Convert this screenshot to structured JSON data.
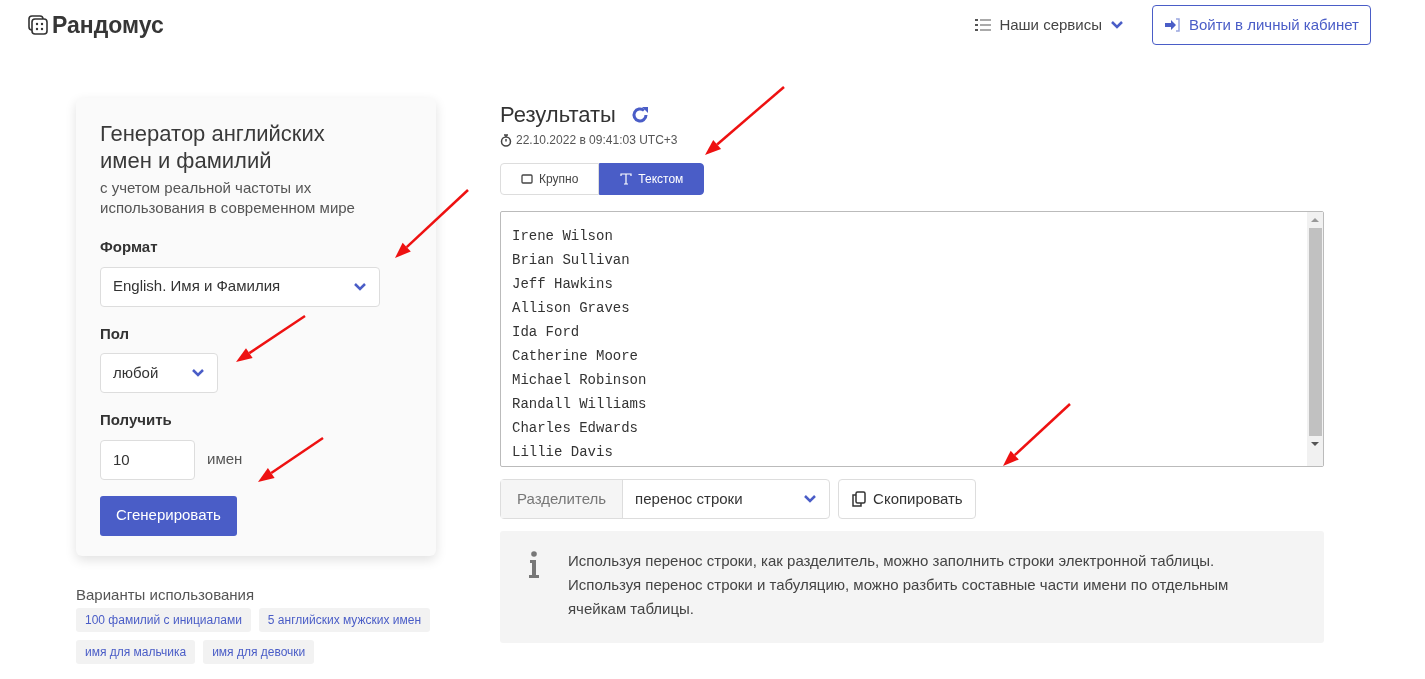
{
  "header": {
    "logo": "Рандомус",
    "services": "Наши сервисы",
    "login": "Войти в личный кабинет"
  },
  "generator": {
    "title": "Генератор английских имен и фамилий",
    "subtitle": "с учетом реальной частоты их использования в современном мире",
    "format_label": "Формат",
    "format_value": "English. Имя и Фамилия",
    "gender_label": "Пол",
    "gender_value": "любой",
    "count_label": "Получить",
    "count_value": "10",
    "count_unit": "имен",
    "submit": "Сгенерировать"
  },
  "usage": {
    "title": "Варианты использования",
    "tags": [
      "100 фамилий с инициалами",
      "5 английских мужских имен",
      "имя для мальчика",
      "имя для девочки"
    ]
  },
  "results": {
    "title": "Результаты",
    "timestamp": "22.10.2022 в 09:41:03 UTC+3",
    "tabs": [
      {
        "label": "Крупно",
        "kind": "large",
        "selected": false
      },
      {
        "label": "Текстом",
        "kind": "text",
        "selected": true
      }
    ],
    "names": [
      "Irene Wilson",
      "Brian Sullivan",
      "Jeff Hawkins",
      "Allison Graves",
      "Ida Ford",
      "Catherine Moore",
      "Michael Robinson",
      "Randall Williams",
      "Charles Edwards",
      "Lillie Davis"
    ],
    "separator_label": "Разделитель",
    "separator_value": "перенос строки",
    "copy": "Скопировать",
    "info": "Используя перенос строки, как разделитель, можно заполнить строки электронной таблицы. Используя перенос строки и табуляцию, можно разбить составные части имени по отдельным ячейкам таблицы."
  }
}
